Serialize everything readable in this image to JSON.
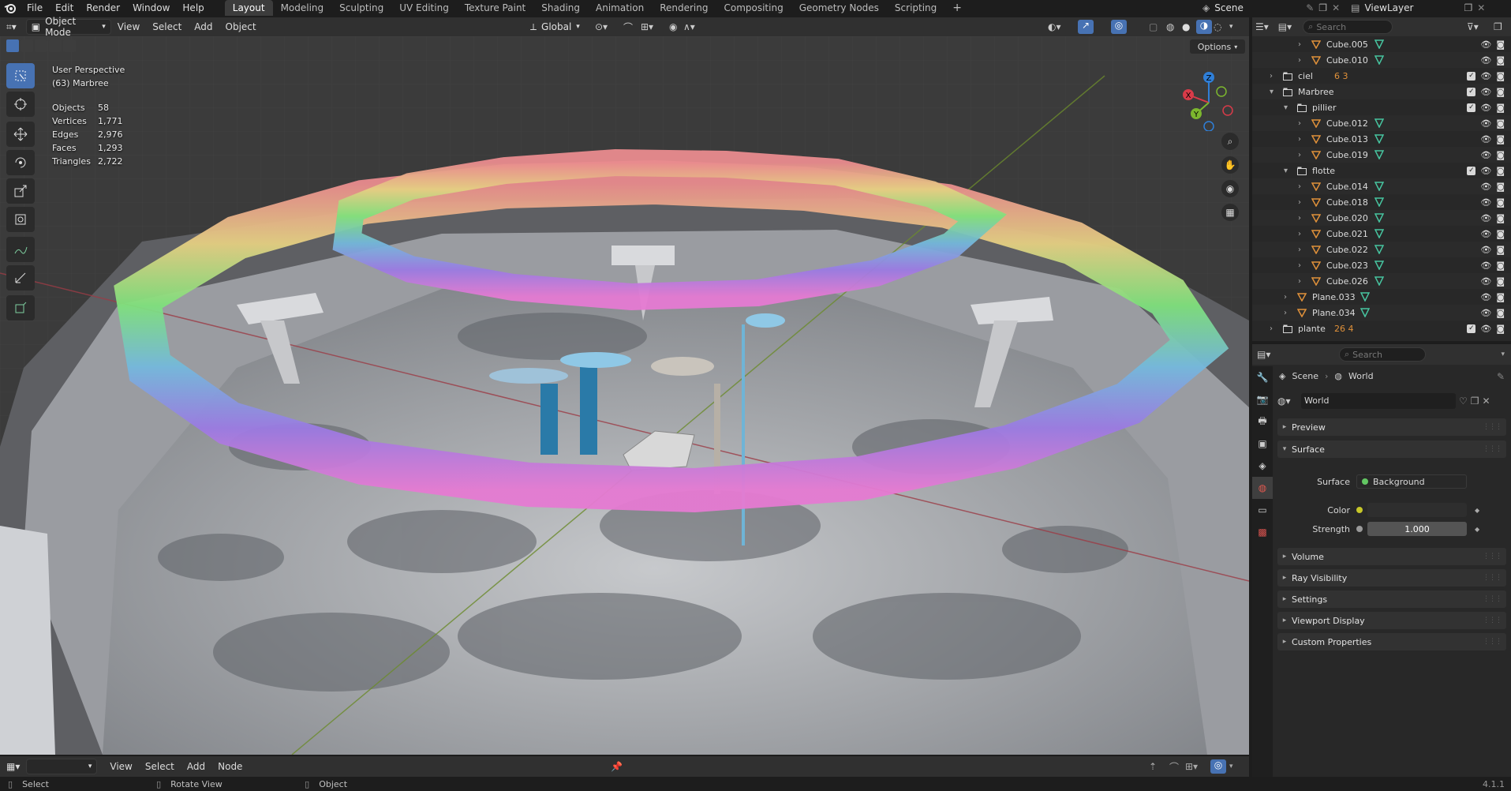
{
  "menu": {
    "items": [
      "File",
      "Edit",
      "Render",
      "Window",
      "Help"
    ]
  },
  "workspaces": {
    "tabs": [
      "Layout",
      "Modeling",
      "Sculpting",
      "UV Editing",
      "Texture Paint",
      "Shading",
      "Animation",
      "Rendering",
      "Compositing",
      "Geometry Nodes",
      "Scripting"
    ],
    "active": "Layout"
  },
  "scene": {
    "name": "Scene",
    "view_layer": "ViewLayer"
  },
  "viewport_header": {
    "mode": "Object Mode",
    "menus": [
      "View",
      "Select",
      "Add",
      "Object"
    ],
    "orientation": "Global",
    "options_label": "Options"
  },
  "viewport": {
    "perspective": "User Perspective",
    "active_object": "(63) Marbree",
    "stats": [
      {
        "label": "Objects",
        "value": "58"
      },
      {
        "label": "Vertices",
        "value": "1,771"
      },
      {
        "label": "Edges",
        "value": "2,976"
      },
      {
        "label": "Faces",
        "value": "1,293"
      },
      {
        "label": "Triangles",
        "value": "2,722"
      }
    ],
    "gizmo": {
      "x": "X",
      "y": "Y",
      "z": "Z"
    }
  },
  "bottom_editor": {
    "menus": [
      "View",
      "Select",
      "Add",
      "Node"
    ]
  },
  "statusbar": {
    "select": "Select",
    "rotate": "Rotate View",
    "object": "Object",
    "version": "4.1.1"
  },
  "outliner": {
    "search_placeholder": "Search",
    "rows": [
      {
        "name": "Cube.005",
        "type": "mesh",
        "indent": 3,
        "expand": "closed"
      },
      {
        "name": "Cube.010",
        "type": "mesh",
        "indent": 3,
        "expand": "closed"
      },
      {
        "name": "ciel",
        "type": "collection",
        "indent": 1,
        "expand": "closed",
        "extra": "6 3"
      },
      {
        "name": "Marbree",
        "type": "collection",
        "indent": 1,
        "expand": "open"
      },
      {
        "name": "pillier",
        "type": "collection",
        "indent": 2,
        "expand": "open"
      },
      {
        "name": "Cube.012",
        "type": "mesh",
        "indent": 3,
        "expand": "closed"
      },
      {
        "name": "Cube.013",
        "type": "mesh",
        "indent": 3,
        "expand": "closed"
      },
      {
        "name": "Cube.019",
        "type": "mesh",
        "indent": 3,
        "expand": "closed"
      },
      {
        "name": "flotte",
        "type": "collection",
        "indent": 2,
        "expand": "open"
      },
      {
        "name": "Cube.014",
        "type": "mesh",
        "indent": 3,
        "expand": "closed"
      },
      {
        "name": "Cube.018",
        "type": "mesh",
        "indent": 3,
        "expand": "closed"
      },
      {
        "name": "Cube.020",
        "type": "mesh",
        "indent": 3,
        "expand": "closed"
      },
      {
        "name": "Cube.021",
        "type": "mesh",
        "indent": 3,
        "expand": "closed"
      },
      {
        "name": "Cube.022",
        "type": "mesh",
        "indent": 3,
        "expand": "closed"
      },
      {
        "name": "Cube.023",
        "type": "mesh",
        "indent": 3,
        "expand": "closed"
      },
      {
        "name": "Cube.026",
        "type": "mesh",
        "indent": 3,
        "expand": "closed"
      },
      {
        "name": "Plane.033",
        "type": "mesh",
        "indent": 2,
        "expand": "closed"
      },
      {
        "name": "Plane.034",
        "type": "mesh",
        "indent": 2,
        "expand": "closed"
      },
      {
        "name": "plante",
        "type": "collection",
        "indent": 1,
        "expand": "closed",
        "extra": "26 4"
      }
    ]
  },
  "properties": {
    "search_placeholder": "Search",
    "breadcrumb": [
      "Scene",
      "World"
    ],
    "world_name": "World",
    "panels": {
      "preview": "Preview",
      "surface": "Surface",
      "volume": "Volume",
      "ray_visibility": "Ray Visibility",
      "settings": "Settings",
      "viewport_display": "Viewport Display",
      "custom_properties": "Custom Properties"
    },
    "surface_label": "Surface",
    "surface_value": "Background",
    "color_label": "Color",
    "strength_label": "Strength",
    "strength_value": "1.000",
    "color_swatch": "#3a3a3a"
  },
  "colors": {
    "accent": "#4772b3",
    "collection_icon": "#cfcfcf",
    "mesh_icon": "#e0913a",
    "vert_icon": "#47c5a0"
  }
}
